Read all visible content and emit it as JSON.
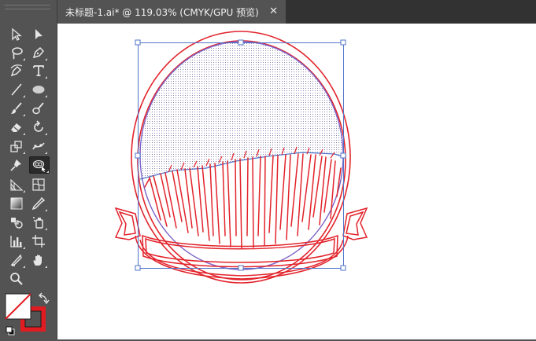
{
  "window": {
    "tab_title": "未标题-1.ai* @ 119.03% (CMYK/GPU 预览)",
    "close_glyph": "✕"
  },
  "toolbar": {
    "tools": [
      {
        "name": "selection-tool",
        "icon": "arrow-outline-icon"
      },
      {
        "name": "direct-selection-tool",
        "icon": "arrow-filled-icon"
      },
      {
        "name": "lasso-tool",
        "icon": "lasso-icon"
      },
      {
        "name": "pen-tool",
        "icon": "pen-nib-icon"
      },
      {
        "name": "curvature-tool",
        "icon": "curvature-pen-icon"
      },
      {
        "name": "type-tool",
        "icon": "type-t-icon"
      },
      {
        "name": "line-tool",
        "icon": "line-segment-icon"
      },
      {
        "name": "ellipse-tool",
        "icon": "ellipse-icon"
      },
      {
        "name": "paintbrush-tool",
        "icon": "paintbrush-icon"
      },
      {
        "name": "blob-brush-tool",
        "icon": "blob-brush-icon"
      },
      {
        "name": "eraser-tool",
        "icon": "eraser-icon"
      },
      {
        "name": "rotate-tool",
        "icon": "rotate-icon"
      },
      {
        "name": "scale-tool",
        "icon": "scale-icon"
      },
      {
        "name": "puppet-warp-tool",
        "icon": "puppet-warp-icon"
      },
      {
        "name": "pin-tool",
        "icon": "pushpin-icon"
      },
      {
        "name": "shape-builder-tool",
        "icon": "shape-builder-icon"
      },
      {
        "name": "perspective-grid-tool",
        "icon": "perspective-grid-icon"
      },
      {
        "name": "mesh-tool",
        "icon": "mesh-icon"
      },
      {
        "name": "gradient-tool",
        "icon": "gradient-icon"
      },
      {
        "name": "eyedropper-tool",
        "icon": "eyedropper-icon"
      },
      {
        "name": "blend-tool",
        "icon": "blend-icon"
      },
      {
        "name": "symbol-sprayer-tool",
        "icon": "symbol-sprayer-icon"
      },
      {
        "name": "column-graph-tool",
        "icon": "column-graph-icon"
      },
      {
        "name": "artboard-tool",
        "icon": "artboard-icon"
      },
      {
        "name": "slice-tool",
        "icon": "slice-knife-icon"
      },
      {
        "name": "hand-tool",
        "icon": "hand-icon"
      },
      {
        "name": "zoom-tool",
        "icon": "magnifier-icon"
      }
    ],
    "active_tool": "shape-builder-tool"
  },
  "colors": {
    "fill": "#ffffff",
    "stroke": "#e11b22",
    "artwork_stroke": "#e2232b",
    "selection": "#4f73c9",
    "ellipse_stroke": "#7c64c8"
  }
}
